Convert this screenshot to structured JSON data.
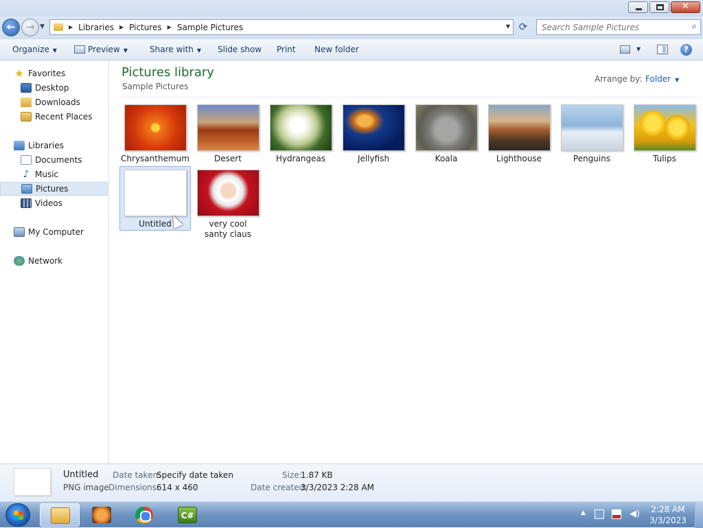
{
  "window": {
    "controls": [
      "minimize",
      "maximize",
      "close"
    ]
  },
  "address": {
    "breadcrumbs": [
      "Libraries",
      "Pictures",
      "Sample Pictures"
    ],
    "search_placeholder": "Search Sample Pictures"
  },
  "toolbar": {
    "organize": "Organize",
    "preview": "Preview",
    "share_with": "Share with",
    "slide_show": "Slide show",
    "print": "Print",
    "new_folder": "New folder"
  },
  "nav": {
    "favorites": "Favorites",
    "desktop": "Desktop",
    "downloads": "Downloads",
    "recent_places": "Recent Places",
    "libraries": "Libraries",
    "documents": "Documents",
    "music": "Music",
    "pictures": "Pictures",
    "videos": "Videos",
    "my_computer": "My Computer",
    "network": "Network",
    "selected": "Pictures"
  },
  "library": {
    "title": "Pictures library",
    "subtitle": "Sample Pictures",
    "arrange_label": "Arrange by:",
    "arrange_value": "Folder"
  },
  "files": [
    {
      "name": "Chrysanthemum"
    },
    {
      "name": "Desert"
    },
    {
      "name": "Hydrangeas"
    },
    {
      "name": "Jellyfish"
    },
    {
      "name": "Koala"
    },
    {
      "name": "Lighthouse"
    },
    {
      "name": "Penguins"
    },
    {
      "name": "Tulips"
    },
    {
      "name": "Untitled",
      "selected": true
    },
    {
      "name": "very cool santy claus"
    }
  ],
  "details": {
    "name": "Untitled",
    "type": "PNG image",
    "date_taken_label": "Date taken:",
    "date_taken": "Specify date taken",
    "dimensions_label": "Dimensions:",
    "dimensions": "614 x 460",
    "size_label": "Size:",
    "size": "1.87 KB",
    "date_created_label": "Date created:",
    "date_created": "3/3/2023 2:28 AM"
  },
  "taskbar": {
    "apps": [
      "windows-explorer",
      "media-player",
      "google-chrome",
      "csharp-ide"
    ],
    "csharp_label": "C#",
    "time": "2:28 AM",
    "date": "3/3/2023"
  },
  "colors": {
    "library_title": "#1e6c2f",
    "link_blue": "#1e5aa8",
    "selection": "#d9e7f9"
  }
}
